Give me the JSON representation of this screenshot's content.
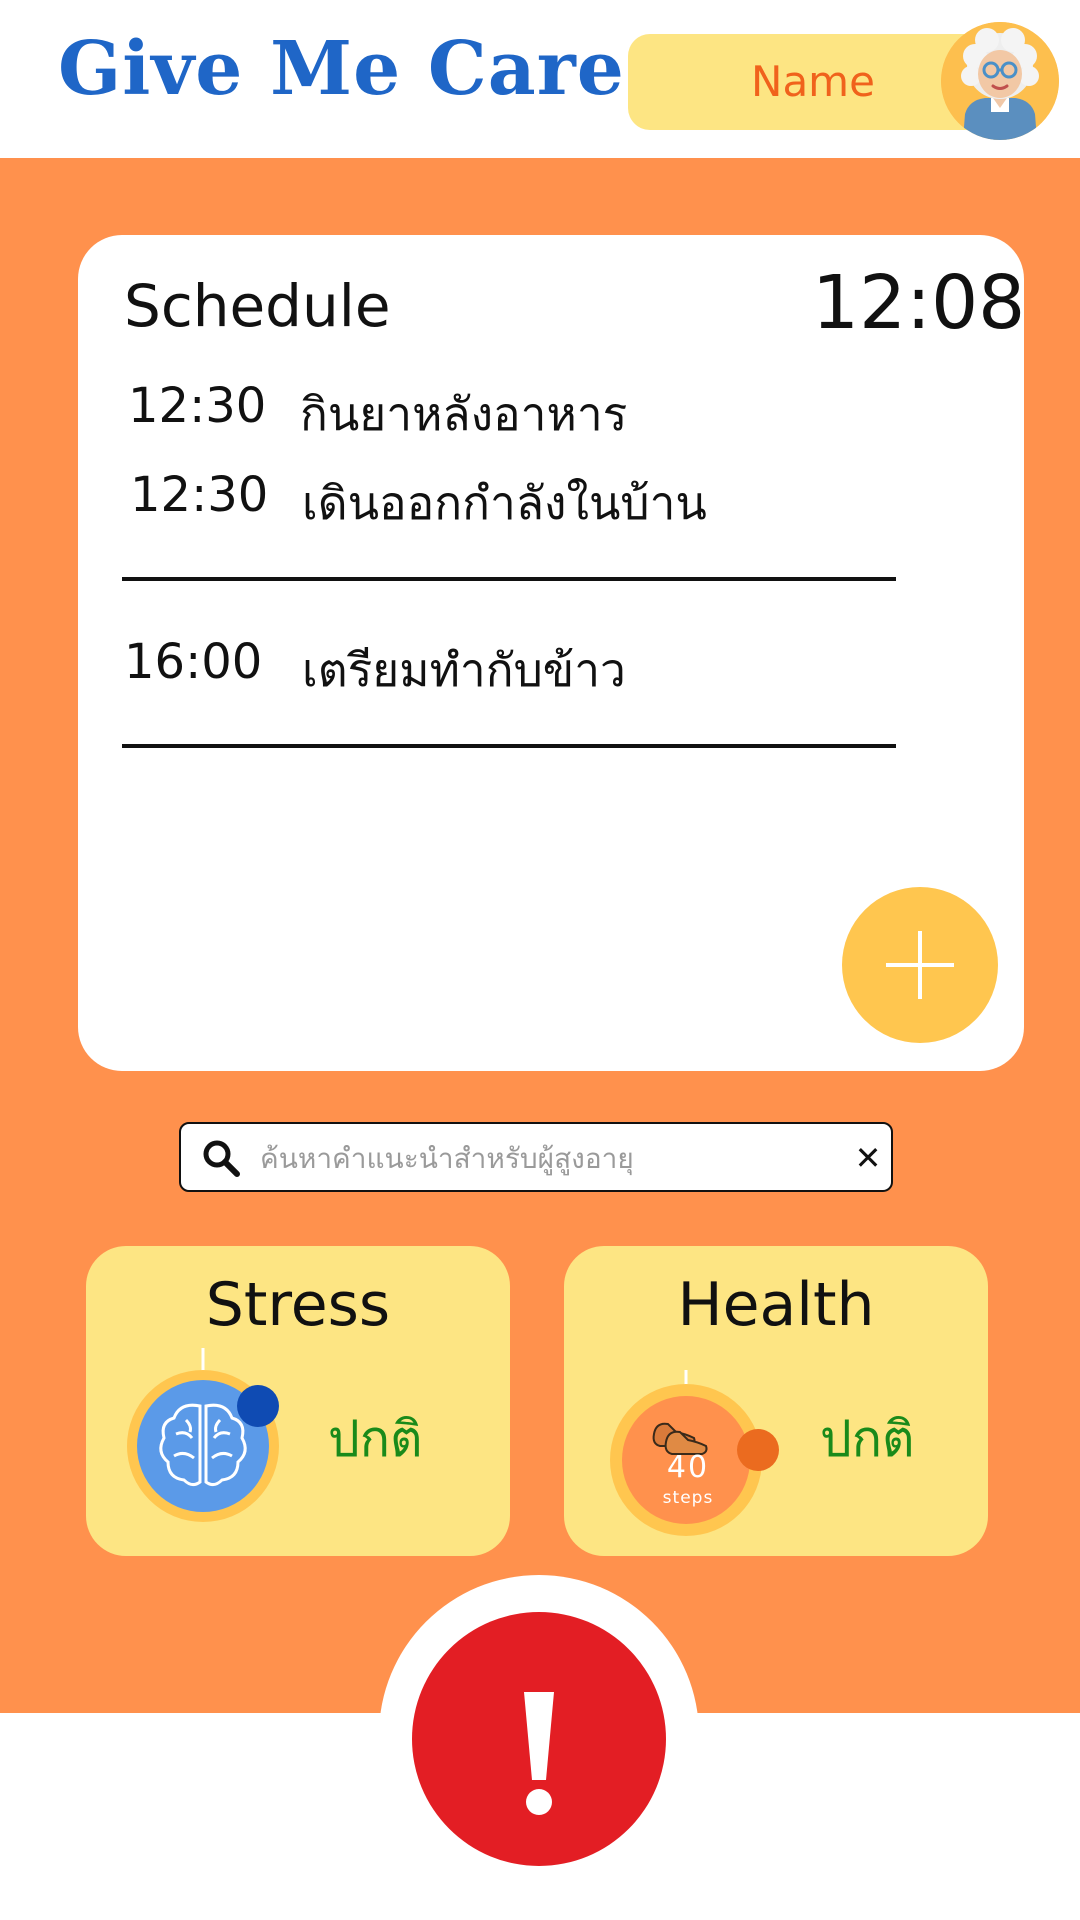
{
  "header": {
    "app_title": "Give Me Care",
    "name_label": "Name"
  },
  "schedule": {
    "title": "Schedule",
    "current_time": "12:08",
    "items": [
      {
        "time": "12:30",
        "task": "กินยาหลังอาหาร"
      },
      {
        "time": "12:30",
        "task": "เดินออกกำลังในบ้าน"
      },
      {
        "time": "16:00",
        "task": "เตรียมทำกับข้าว"
      }
    ]
  },
  "search": {
    "placeholder": "ค้นหาคำแนะนำสำหรับผู้สูงอายุ",
    "value": ""
  },
  "stress": {
    "title": "Stress",
    "status": "ปกติ"
  },
  "health": {
    "title": "Health",
    "status": "ปกติ",
    "steps_value": "40",
    "steps_unit": "steps"
  },
  "icons": {
    "avatar": "elderly-woman-avatar",
    "add": "plus-icon",
    "search": "search-icon",
    "clear": "close-icon",
    "stress": "brain-icon",
    "health": "shoe-icon",
    "alert": "exclamation-icon"
  },
  "colors": {
    "brand_blue": "#1f66c7",
    "accent_orange": "#ff914d",
    "card_yellow": "#fde583",
    "add_button_yellow": "#ffc64f",
    "status_green": "#1a8a1a",
    "alert_red": "#e31e24"
  }
}
